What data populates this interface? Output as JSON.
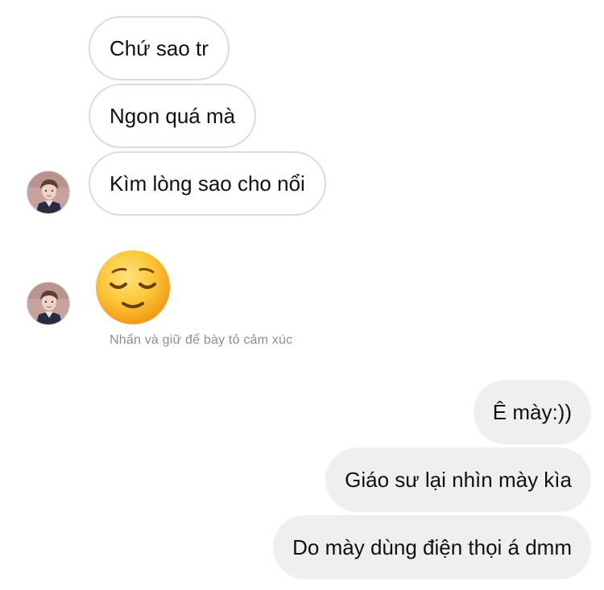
{
  "incoming": {
    "messages": [
      "Chứ sao tr",
      "Ngon quá mà",
      "Kìm lòng sao cho nổi"
    ],
    "reaction_emoji": "relieved-face-emoji",
    "hint": "Nhấn và giữ để bày tỏ cảm xúc"
  },
  "outgoing": {
    "messages": [
      "Ê mày:))",
      "Giáo sư lại nhìn mày kìa",
      "Do mày dùng điện thọi á dmm"
    ]
  },
  "colors": {
    "incoming_bubble_bg": "#ffffff",
    "incoming_bubble_border": "#dbdbdb",
    "outgoing_bubble_bg": "#efefef",
    "hint_text": "#8e8e8e"
  },
  "icons": [
    "avatar",
    "relieved-face-emoji"
  ]
}
